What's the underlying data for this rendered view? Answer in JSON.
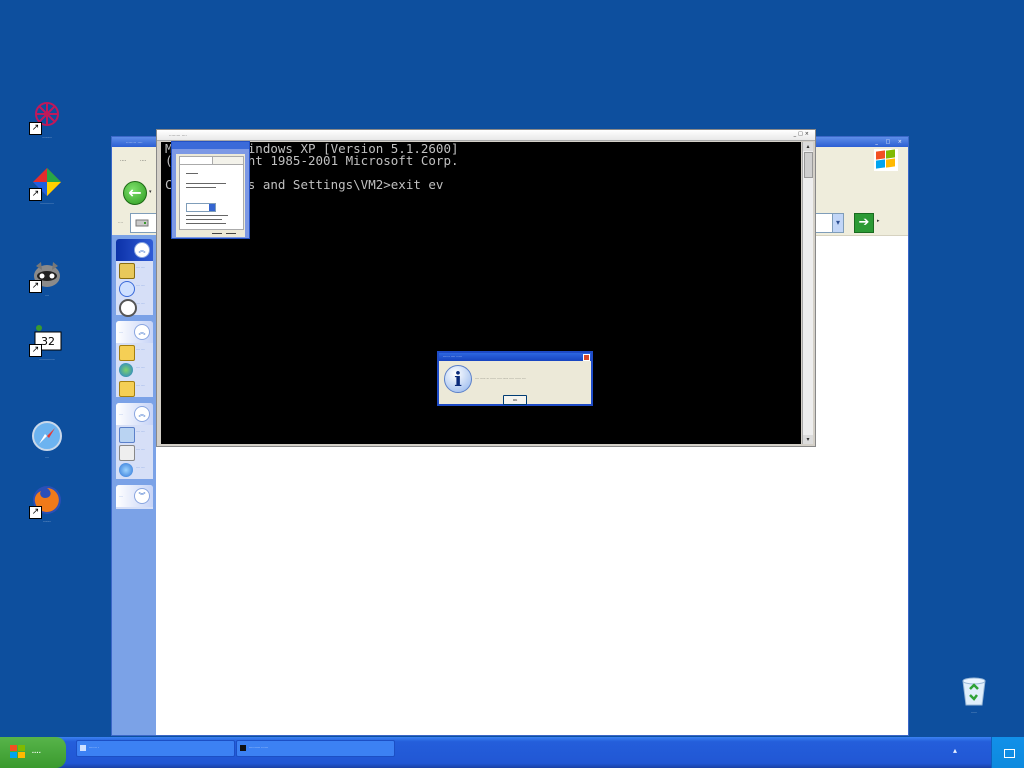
{
  "desktop": {
    "icons": [
      {
        "name": "icon-1",
        "caption": "..........."
      },
      {
        "name": "icon-2",
        "caption": ".............."
      },
      {
        "name": "icon-3",
        "caption": "...."
      },
      {
        "name": "icon-4",
        "caption": "................"
      },
      {
        "name": "icon-5",
        "caption": "...."
      },
      {
        "name": "icon-6",
        "caption": "........."
      },
      {
        "name": "recycle-bin",
        "caption": "......"
      }
    ]
  },
  "explorer": {
    "title": "........ ....",
    "menu": [
      "....",
      "...."
    ],
    "back_dropdown": "▾",
    "address_label": "....",
    "go_label": "▸",
    "panels": [
      {
        "title": "",
        "items": [
          ".... ....",
          ".... ....",
          ".... ...."
        ]
      },
      {
        "title": "....",
        "items": [
          ".... ....",
          ".... ....",
          ".... ...."
        ]
      },
      {
        "title": "....",
        "items": [
          ".... ....",
          ".... ....",
          ".... ...."
        ]
      },
      {
        "title": "....",
        "items": []
      }
    ]
  },
  "cmd": {
    "title": "......... ....",
    "lines": [
      "Microsoft Windows XP [Version 5.1.2600]",
      "(C) Copyright 1985-2001 Microsoft Corp.",
      "",
      "C:\\Documents and Settings\\VM2>exit ev"
    ]
  },
  "dialog": {
    "title": "...... .... .....",
    "message": ".... ...... ... ...... ..... ...... ..... ...... ....",
    "ok": "OK"
  },
  "taskbar": {
    "start_label": "....",
    "buttons": [
      {
        "label": "....... ."
      },
      {
        "label": ".......... ......"
      }
    ]
  },
  "colors": {
    "desktop": "#0d4f9e",
    "taskbar": "#2157d4",
    "start": "#3a9a2e"
  }
}
